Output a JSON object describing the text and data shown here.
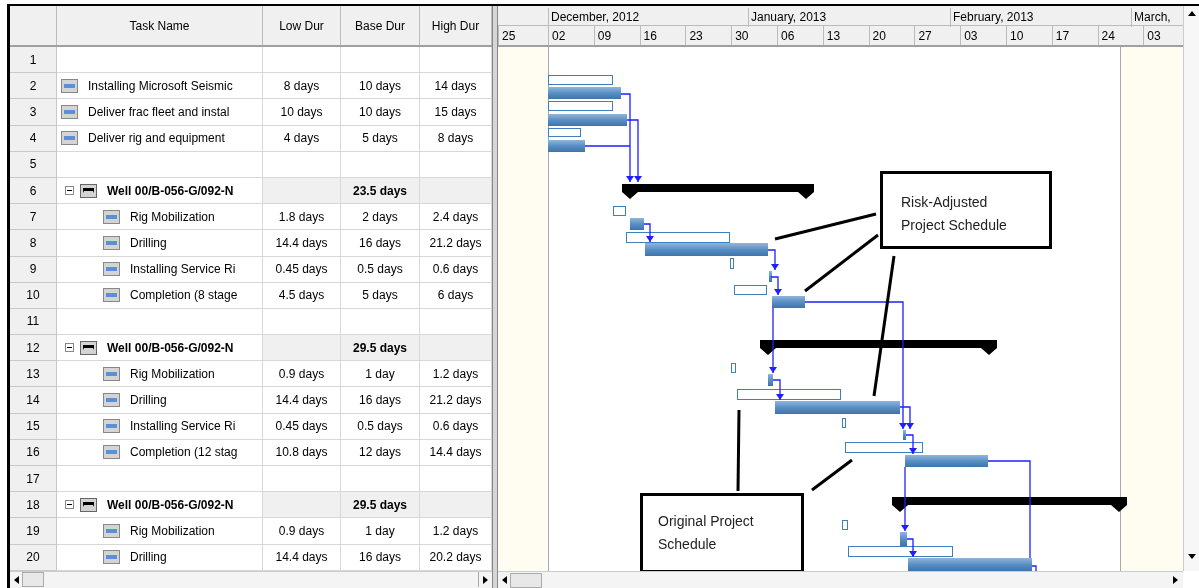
{
  "columns": [
    "Task Name",
    "Low Dur",
    "Base Dur",
    "High Dur"
  ],
  "rows": [
    {
      "row_number": "1",
      "kind": "blank"
    },
    {
      "row_number": "2",
      "kind": "task",
      "name": "Installing Microsoft Seismic",
      "low": "8 days",
      "base": "10 days",
      "high": "14 days"
    },
    {
      "row_number": "3",
      "kind": "task",
      "name": "Deliver frac fleet and instal",
      "low": "10 days",
      "base": "10 days",
      "high": "15 days"
    },
    {
      "row_number": "4",
      "kind": "task",
      "name": "Deliver rig and equipment",
      "low": "4 days",
      "base": "5 days",
      "high": "8 days"
    },
    {
      "row_number": "5",
      "kind": "blank"
    },
    {
      "row_number": "6",
      "kind": "summary",
      "expanded": true,
      "name": "Well 00/B-056-G/092-N",
      "base": "23.5 days",
      "children": [
        {
          "row_number": "7",
          "kind": "task",
          "name": "Rig Mobilization",
          "low": "1.8 days",
          "base": "2 days",
          "high": "2.4 days"
        },
        {
          "row_number": "8",
          "kind": "task",
          "name": "Drilling",
          "low": "14.4 days",
          "base": "16 days",
          "high": "21.2 days"
        },
        {
          "row_number": "9",
          "kind": "task",
          "name": "Installing Service Ri",
          "low": "0.45 days",
          "base": "0.5 days",
          "high": "0.6 days"
        },
        {
          "row_number": "10",
          "kind": "task",
          "name": "Completion (8 stage",
          "low": "4.5 days",
          "base": "5 days",
          "high": "6 days"
        }
      ]
    },
    {
      "row_number": "11",
      "kind": "blank"
    },
    {
      "row_number": "12",
      "kind": "summary",
      "expanded": true,
      "name": "Well 00/B-056-G/092-N",
      "base": "29.5 days",
      "children": [
        {
          "row_number": "13",
          "kind": "task",
          "name": "Rig Mobilization",
          "low": "0.9 days",
          "base": "1 day",
          "high": "1.2 days"
        },
        {
          "row_number": "14",
          "kind": "task",
          "name": "Drilling",
          "low": "14.4 days",
          "base": "16 days",
          "high": "21.2 days"
        },
        {
          "row_number": "15",
          "kind": "task",
          "name": "Installing Service Ri",
          "low": "0.45 days",
          "base": "0.5 days",
          "high": "0.6 days"
        },
        {
          "row_number": "16",
          "kind": "task",
          "name": "Completion (12 stag",
          "low": "10.8 days",
          "base": "12 days",
          "high": "14.4 days"
        }
      ]
    },
    {
      "row_number": "17",
      "kind": "blank"
    },
    {
      "row_number": "18",
      "kind": "summary",
      "expanded": true,
      "name": "Well 00/B-056-G/092-N",
      "base": "29.5 days",
      "children": [
        {
          "row_number": "19",
          "kind": "task",
          "name": "Rig Mobilization",
          "low": "0.9 days",
          "base": "1 day",
          "high": "1.2 days"
        },
        {
          "row_number": "20",
          "kind": "task",
          "name": "Drilling",
          "low": "14.4 days",
          "base": "16 days",
          "high": "20.2 days"
        }
      ]
    }
  ],
  "timescale": {
    "months": [
      "December, 2012",
      "January, 2013",
      "February, 2013",
      "March,"
    ],
    "weeks": [
      "25",
      "02",
      "09",
      "16",
      "23",
      "30",
      "06",
      "13",
      "20",
      "27",
      "03",
      "10",
      "17",
      "24",
      "03"
    ]
  },
  "callouts": [
    {
      "lines": [
        "Risk-Adjusted",
        "Project Schedule"
      ]
    },
    {
      "lines": [
        "Original Project",
        "Schedule"
      ]
    }
  ]
}
